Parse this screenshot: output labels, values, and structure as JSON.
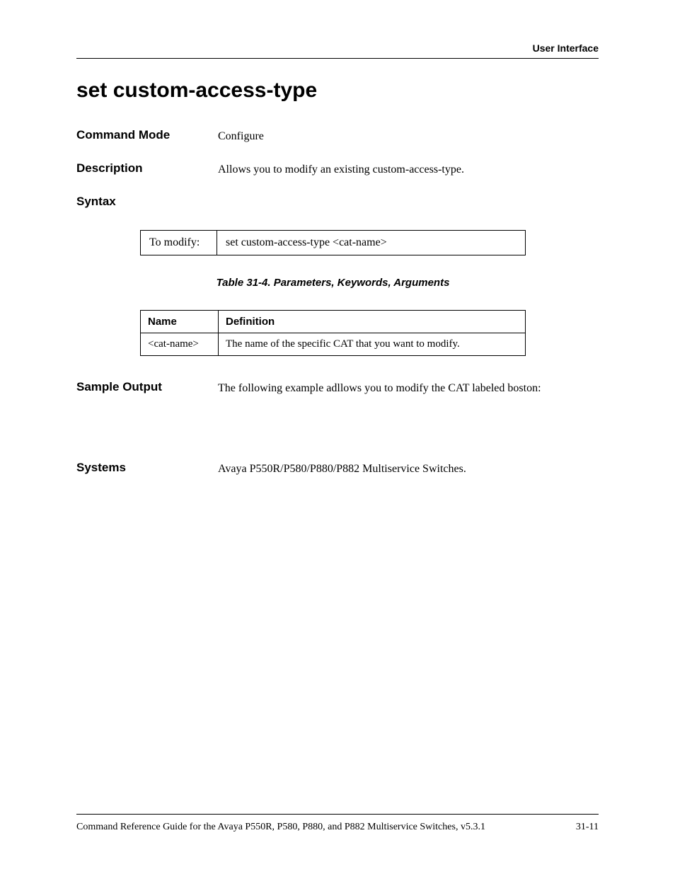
{
  "header": {
    "section_label": "User Interface"
  },
  "title": "set custom-access-type",
  "command_mode": {
    "label": "Command Mode",
    "value": "Configure"
  },
  "description": {
    "label": "Description",
    "value": "Allows you to modify an existing custom-access-type."
  },
  "syntax": {
    "label": "Syntax",
    "action_label": "To modify:",
    "command": "set custom-access-type <cat-name>"
  },
  "params_table": {
    "caption": "Table 31-4.  Parameters, Keywords, Arguments",
    "headers": {
      "name": "Name",
      "definition": "Definition"
    },
    "rows": [
      {
        "name": "<cat-name>",
        "definition": "The name of the specific CAT that you want to modify."
      }
    ]
  },
  "sample_output": {
    "label": "Sample Output",
    "value": "The following example adllows you to modify the CAT labeled boston:"
  },
  "systems": {
    "label": "Systems",
    "value": "Avaya P550R/P580/P880/P882 Multiservice Switches."
  },
  "footer": {
    "left": "Command Reference Guide for the Avaya P550R, P580, P880, and P882 Multiservice Switches, v5.3.1",
    "right": "31-11"
  }
}
